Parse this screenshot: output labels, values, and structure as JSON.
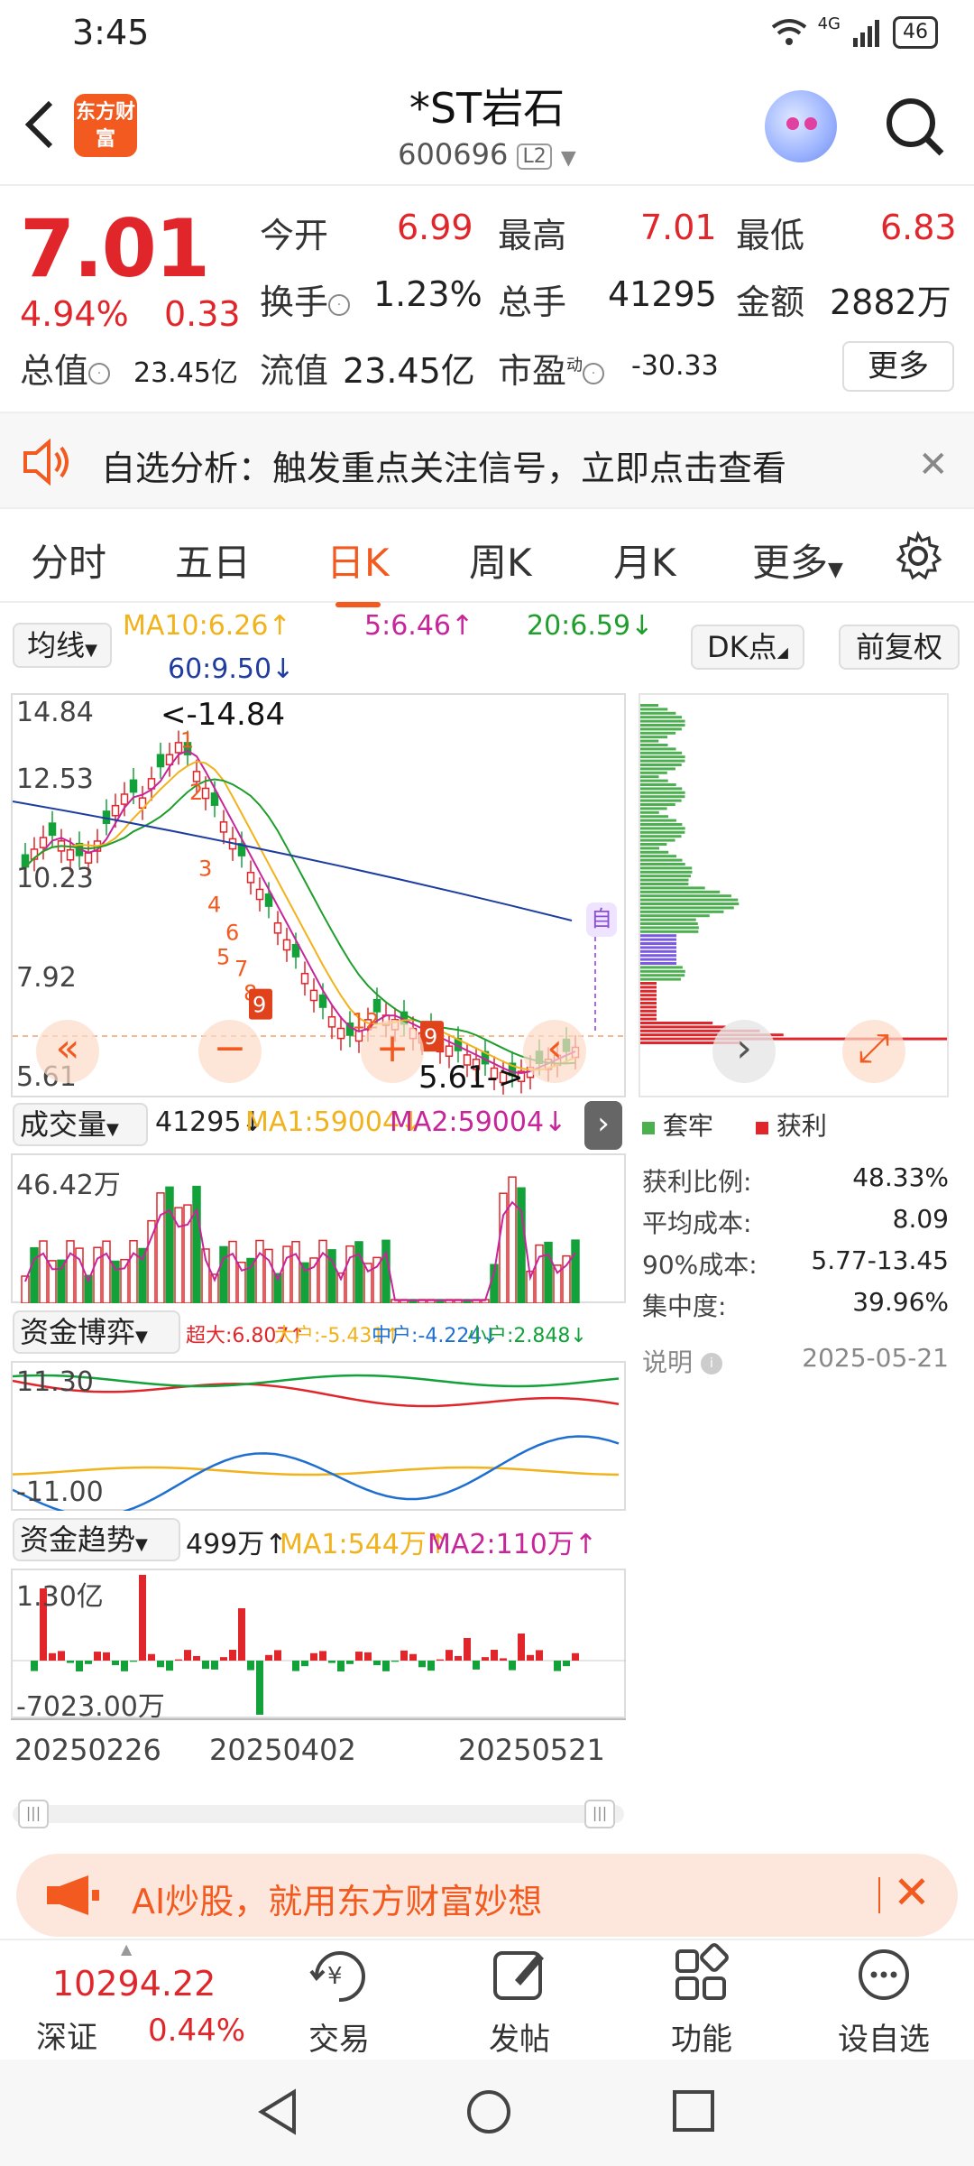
{
  "status": {
    "time": "3:45",
    "network": "4G",
    "battery": "46"
  },
  "header": {
    "logo": "东方财富",
    "title": "*ST岩石",
    "code": "600696",
    "level": "L2"
  },
  "quote": {
    "price": "7.01",
    "change_pct": "4.94%",
    "change": "0.33",
    "open_label": "今开",
    "open": "6.99",
    "high_label": "最高",
    "high": "7.01",
    "low_label": "最低",
    "low": "6.83",
    "turnover_label": "换手",
    "turnover": "1.23%",
    "volume_label": "总手",
    "volume": "41295",
    "amount_label": "金额",
    "amount": "2882万",
    "mktcap_label": "总值",
    "mktcap": "23.45亿",
    "float_label": "流值",
    "float": "23.45亿",
    "pe_label": "市盈",
    "pe_sup": "动",
    "pe": "-30.33",
    "more": "更多"
  },
  "alert": {
    "text": "自选分析：触发重点关注信号，立即点击查看"
  },
  "tabs": [
    {
      "label": "分时"
    },
    {
      "label": "五日"
    },
    {
      "label": "日K",
      "active": true
    },
    {
      "label": "周K"
    },
    {
      "label": "月K"
    },
    {
      "label": "更多"
    }
  ],
  "kline": {
    "ma_button": "均线",
    "ma10": "MA10:6.26↑",
    "ma5": "5:6.46↑",
    "ma20": "20:6.59↓",
    "ma60": "60:9.50↓",
    "dk_button": "DK点",
    "adjust_button": "前复权",
    "y_labels": [
      "14.84",
      "12.53",
      "10.23",
      "7.92",
      "5.61"
    ],
    "max_marker": "<-14.84",
    "min_marker": "5.61->",
    "badge": "自",
    "colors": {
      "up": "#e0262b",
      "down": "#13a13a",
      "ma5": "#c8259a",
      "ma10": "#f2b21c",
      "ma20": "#1f9e2c",
      "ma60": "#1f3da0"
    }
  },
  "chip": {
    "legend_trapped": "套牢",
    "legend_profit": "获利",
    "stats": [
      {
        "label": "获利比例:",
        "value": "48.33%"
      },
      {
        "label": "平均成本:",
        "value": "8.09"
      },
      {
        "label": "90%成本:",
        "value": "5.77-13.45"
      },
      {
        "label": "集中度:",
        "value": "39.96%"
      }
    ],
    "note": "说明",
    "date": "2025-05-21"
  },
  "volume": {
    "label": "成交量",
    "value": "41295↓",
    "ma1": "MA1:59004↓",
    "ma2": "MA2:59004↓",
    "max_label": "46.42万"
  },
  "fund_game": {
    "label": "资金博弈",
    "super": "超大:6.807↑",
    "large": "大户:-5.431↑",
    "medium": "中户:-4.224↓",
    "small": "小户:2.848↓",
    "top": "11.30",
    "bottom": "-11.00"
  },
  "fund_trend": {
    "label": "资金趋势",
    "value": "499万↑",
    "ma1": "MA1:544万↑",
    "ma2": "MA2:110万↑",
    "top": "1.30亿",
    "bottom": "-7023.00万"
  },
  "dates": [
    "20250226",
    "20250402",
    "20250521"
  ],
  "ai_banner": {
    "text": "AI炒股，就用东方财富妙想"
  },
  "bottom_nav": {
    "index_value": "10294.22",
    "index_name": "深证",
    "index_pct": "0.44%",
    "items": [
      {
        "label": "交易"
      },
      {
        "label": "发帖"
      },
      {
        "label": "功能"
      },
      {
        "label": "设自选"
      }
    ]
  }
}
